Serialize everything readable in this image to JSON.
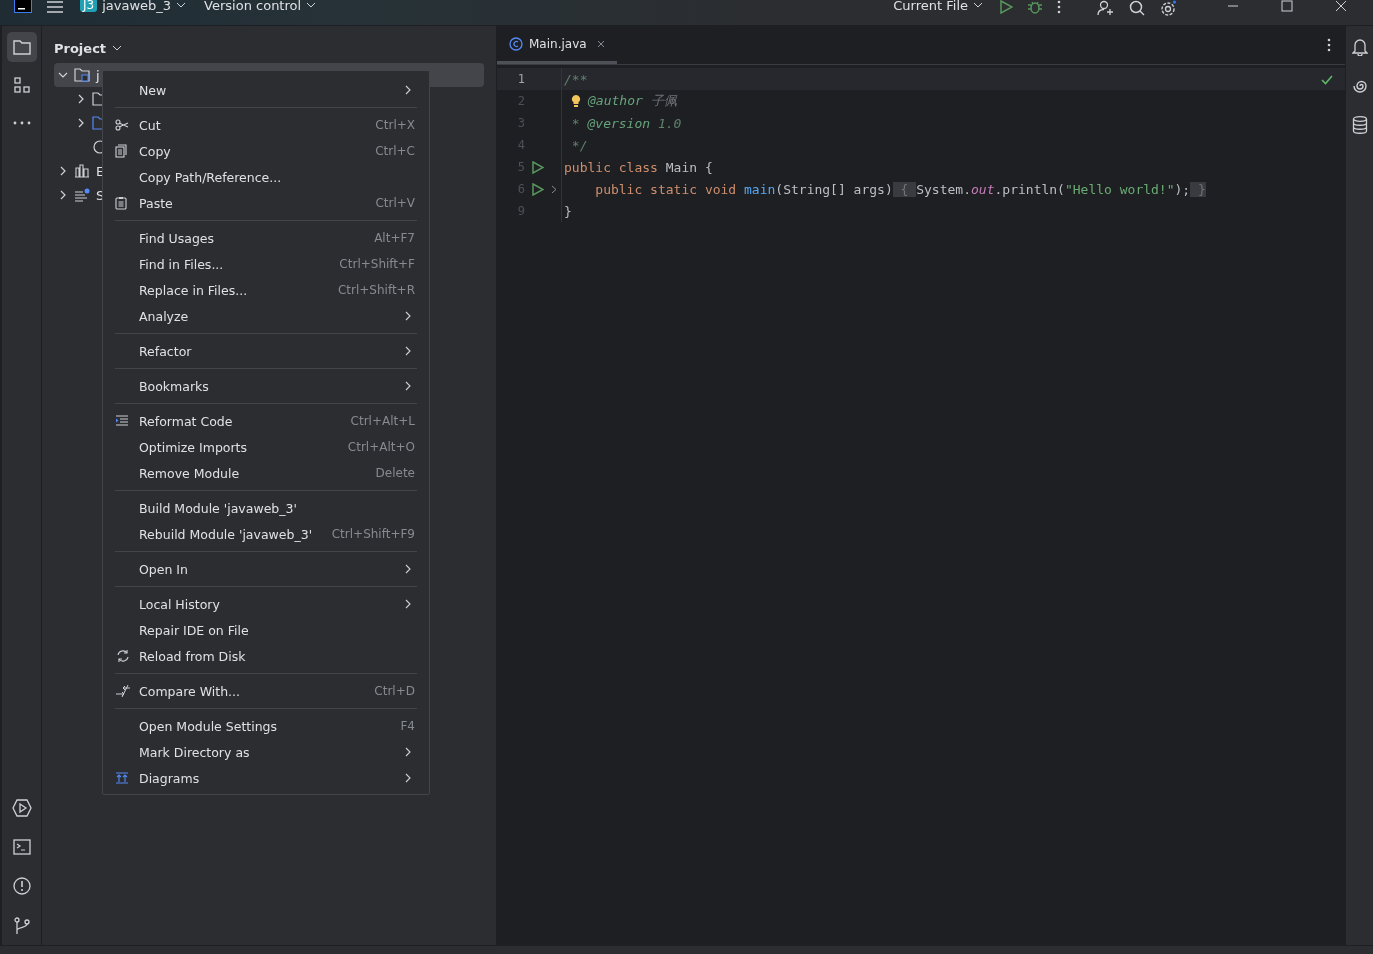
{
  "title_bar": {
    "project_badge": "J3",
    "project": "javaweb_3",
    "vcs": "Version control",
    "run_config": "Current File"
  },
  "left_toolbar": [
    {
      "kind": "project",
      "selected": true
    },
    {
      "kind": "structure",
      "selected": false
    },
    {
      "kind": "more",
      "selected": false
    }
  ],
  "left_toolbar_bottom": [
    {
      "kind": "services"
    },
    {
      "kind": "terminal"
    },
    {
      "kind": "problems"
    },
    {
      "kind": "git"
    }
  ],
  "project_panel": {
    "title": "Project",
    "tree": [
      {
        "label": "j",
        "kind": "module",
        "expanded": true,
        "selected": true,
        "children": [
          {
            "kind": "folder",
            "expanded": false
          },
          {
            "kind": "source",
            "expanded": false
          },
          {
            "kind": "file"
          }
        ]
      },
      {
        "label": "E",
        "kind": "libraries",
        "expanded": false,
        "selected": false
      },
      {
        "label": "S",
        "kind": "scratches",
        "expanded": false,
        "selected": false
      }
    ]
  },
  "context_menu": [
    [
      {
        "label": "New",
        "kind": "plain",
        "submenu": true
      }
    ],
    [
      {
        "label": "Cut",
        "kind": "cut",
        "shortcut": "Ctrl+X",
        "submenu": false
      },
      {
        "label": "Copy",
        "kind": "copy",
        "shortcut": "Ctrl+C",
        "submenu": false
      },
      {
        "label": "Copy Path/Reference...",
        "kind": "plain",
        "submenu": false
      },
      {
        "label": "Paste",
        "kind": "paste",
        "shortcut": "Ctrl+V",
        "submenu": false
      }
    ],
    [
      {
        "label": "Find Usages",
        "kind": "plain",
        "shortcut": "Alt+F7",
        "submenu": false
      },
      {
        "label": "Find in Files...",
        "kind": "plain",
        "shortcut": "Ctrl+Shift+F",
        "submenu": false
      },
      {
        "label": "Replace in Files...",
        "kind": "plain",
        "shortcut": "Ctrl+Shift+R",
        "submenu": false
      },
      {
        "label": "Analyze",
        "kind": "plain",
        "submenu": true
      }
    ],
    [
      {
        "label": "Refactor",
        "kind": "plain",
        "submenu": true
      }
    ],
    [
      {
        "label": "Bookmarks",
        "kind": "plain",
        "submenu": true
      }
    ],
    [
      {
        "label": "Reformat Code",
        "kind": "reformat",
        "shortcut": "Ctrl+Alt+L",
        "submenu": false
      },
      {
        "label": "Optimize Imports",
        "kind": "plain",
        "shortcut": "Ctrl+Alt+O",
        "submenu": false
      },
      {
        "label": "Remove Module",
        "kind": "plain",
        "shortcut": "Delete",
        "submenu": false
      }
    ],
    [
      {
        "label": "Build Module 'javaweb_3'",
        "kind": "plain",
        "submenu": false
      },
      {
        "label": "Rebuild Module 'javaweb_3'",
        "kind": "plain",
        "shortcut": "Ctrl+Shift+F9",
        "submenu": false
      }
    ],
    [
      {
        "label": "Open In",
        "kind": "plain",
        "submenu": true
      }
    ],
    [
      {
        "label": "Local History",
        "kind": "plain",
        "submenu": true
      },
      {
        "label": "Repair IDE on File",
        "kind": "plain",
        "submenu": false
      },
      {
        "label": "Reload from Disk",
        "kind": "reload",
        "submenu": false
      }
    ],
    [
      {
        "label": "Compare With...",
        "kind": "compare",
        "shortcut": "Ctrl+D",
        "submenu": false
      }
    ],
    [
      {
        "label": "Open Module Settings",
        "kind": "plain",
        "shortcut": "F4",
        "submenu": false
      },
      {
        "label": "Mark Directory as",
        "kind": "plain",
        "submenu": true
      },
      {
        "label": "Diagrams",
        "kind": "diagrams",
        "submenu": true
      }
    ]
  ],
  "editor": {
    "tabs": [
      {
        "label": "Main.java",
        "selected": true
      }
    ],
    "lines": [
      {
        "number": "1",
        "current": true,
        "run": false,
        "fold": false,
        "bulb": false,
        "tokens": [
          {
            "text": "/**",
            "kind": "comment"
          }
        ]
      },
      {
        "number": "2",
        "current": false,
        "run": false,
        "fold": false,
        "bulb": true,
        "tokens": [
          {
            "text": "@author",
            "kind": "doctag"
          },
          {
            "text": " 子佩",
            "kind": "doctext"
          }
        ]
      },
      {
        "number": "3",
        "current": false,
        "run": false,
        "fold": false,
        "bulb": false,
        "tokens": [
          {
            "text": " * ",
            "kind": "comment"
          },
          {
            "text": "@version",
            "kind": "doctag"
          },
          {
            "text": " 1.0",
            "kind": "comment"
          }
        ]
      },
      {
        "number": "4",
        "current": false,
        "run": false,
        "fold": false,
        "bulb": false,
        "tokens": [
          {
            "text": " */",
            "kind": "comment"
          }
        ]
      },
      {
        "number": "5",
        "current": false,
        "run": true,
        "fold": false,
        "bulb": false,
        "tokens": [
          {
            "text": "public class ",
            "kind": "keyword"
          },
          {
            "text": "Main {",
            "kind": "plain"
          }
        ]
      },
      {
        "number": "6",
        "current": false,
        "run": true,
        "fold": true,
        "bulb": false,
        "tokens": [
          {
            "text": "    public static void ",
            "kind": "keyword"
          },
          {
            "text": "main",
            "kind": "method"
          },
          {
            "text": "(String[] args)",
            "kind": "plain"
          },
          {
            "text": " { ",
            "kind": "folded"
          },
          {
            "text": "System.",
            "kind": "plain"
          },
          {
            "text": "out",
            "kind": "field"
          },
          {
            "text": ".println(",
            "kind": "plain"
          },
          {
            "text": "\"Hello world!\"",
            "kind": "string"
          },
          {
            "text": ");",
            "kind": "plain"
          },
          {
            "text": " }",
            "kind": "folded"
          }
        ]
      },
      {
        "number": "9",
        "current": false,
        "run": false,
        "fold": false,
        "bulb": false,
        "tokens": [
          {
            "text": "}",
            "kind": "plain"
          }
        ]
      }
    ]
  },
  "right_toolbar": [
    {
      "kind": "notifications"
    },
    {
      "kind": "ai"
    },
    {
      "kind": "database"
    }
  ]
}
